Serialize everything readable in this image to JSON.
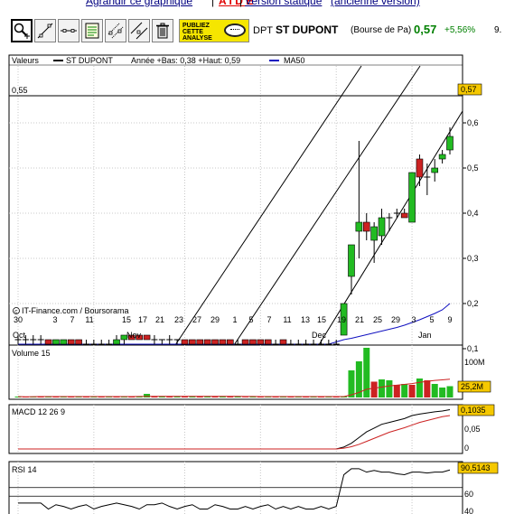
{
  "top_links": {
    "zoom": "Agrandir ce graphique",
    "sep1": "|",
    "aide": "A I D E",
    "sep2": "|",
    "static": "Version statique",
    "old": "(ancienne version)"
  },
  "toolbar": {
    "tools": [
      "zoom-tool",
      "trendline-tool",
      "horizontal-line-tool",
      "annotation-tool",
      "channel-tool",
      "parallel-lines-tool",
      "delete-tool"
    ],
    "publish_ad": [
      "PUBLIEZ",
      "CETTE",
      "ANALYSE"
    ]
  },
  "quote": {
    "mnemo": "DPT",
    "name": "ST DUPONT",
    "market": "(Bourse de Pa)",
    "last": "0,57",
    "variation": "+5,56%",
    "more": "9."
  },
  "colors": {
    "up": "#22bb22",
    "down": "#cc2222",
    "ma": "#1010c0",
    "lastbox": "#f5c800",
    "grid": "#c8c8c8"
  },
  "price_panel": {
    "header": [
      "Valeurs",
      "ST DUPONT",
      "Année +Bas: 0,38 +Haut: 0,59",
      "MA50"
    ],
    "hline_label": "0,55",
    "last_label": "0,57",
    "ticks": [
      "0,6",
      "0,5",
      "0,4",
      "0,3",
      "0,2",
      "0,1"
    ],
    "credit": "IT-Finance.com / Boursorama"
  },
  "xaxis": {
    "days": [
      "30",
      "3",
      "7",
      "11",
      "15",
      "17",
      "21",
      "23",
      "27",
      "29",
      "1",
      "5",
      "7",
      "11",
      "13",
      "15",
      "19",
      "21",
      "25",
      "29",
      "3",
      "5",
      "9"
    ],
    "months": [
      "Oct",
      "Nov",
      "Dec",
      "Jan"
    ]
  },
  "volume_panel": {
    "label": "Volume 15",
    "tick_top": "100M",
    "last": "25,2M"
  },
  "macd_panel": {
    "label": "MACD 12 26 9",
    "last": "0,1035",
    "ticks": [
      "0,05",
      "0"
    ]
  },
  "rsi_panel": {
    "label": "RSI 14",
    "last": "90,5143",
    "ticks": [
      "60",
      "40"
    ]
  },
  "chart_data": {
    "type": "candlestick",
    "ohlc": [
      [
        0.12,
        0.13,
        0.11,
        0.12
      ],
      [
        0.12,
        0.13,
        0.11,
        0.12
      ],
      [
        0.12,
        0.13,
        0.11,
        0.12
      ],
      [
        0.12,
        0.13,
        0.11,
        0.12
      ],
      [
        0.12,
        0.12,
        0.11,
        0.11
      ],
      [
        0.11,
        0.12,
        0.11,
        0.12
      ],
      [
        0.11,
        0.12,
        0.11,
        0.12
      ],
      [
        0.12,
        0.12,
        0.11,
        0.11
      ],
      [
        0.12,
        0.12,
        0.11,
        0.11
      ],
      [
        0.11,
        0.12,
        0.11,
        0.11
      ],
      [
        0.11,
        0.12,
        0.11,
        0.11
      ],
      [
        0.11,
        0.12,
        0.11,
        0.11
      ],
      [
        0.11,
        0.12,
        0.11,
        0.11
      ],
      [
        0.11,
        0.13,
        0.11,
        0.12
      ],
      [
        0.12,
        0.13,
        0.11,
        0.13
      ],
      [
        0.13,
        0.13,
        0.12,
        0.12
      ],
      [
        0.13,
        0.13,
        0.12,
        0.12
      ],
      [
        0.13,
        0.13,
        0.12,
        0.12
      ],
      [
        0.12,
        0.13,
        0.11,
        0.12
      ],
      [
        0.12,
        0.12,
        0.11,
        0.12
      ],
      [
        0.12,
        0.13,
        0.11,
        0.12
      ],
      [
        0.12,
        0.12,
        0.11,
        0.12
      ],
      [
        0.12,
        0.12,
        0.11,
        0.11
      ],
      [
        0.12,
        0.12,
        0.11,
        0.11
      ],
      [
        0.12,
        0.12,
        0.11,
        0.11
      ],
      [
        0.12,
        0.12,
        0.11,
        0.11
      ],
      [
        0.12,
        0.12,
        0.11,
        0.11
      ],
      [
        0.12,
        0.12,
        0.11,
        0.11
      ],
      [
        0.12,
        0.12,
        0.11,
        0.11
      ],
      [
        0.11,
        0.12,
        0.11,
        0.11
      ],
      [
        0.12,
        0.12,
        0.11,
        0.11
      ],
      [
        0.12,
        0.12,
        0.11,
        0.11
      ],
      [
        0.12,
        0.12,
        0.11,
        0.11
      ],
      [
        0.12,
        0.12,
        0.11,
        0.11
      ],
      [
        0.11,
        0.12,
        0.11,
        0.11
      ],
      [
        0.12,
        0.12,
        0.11,
        0.11
      ],
      [
        0.11,
        0.12,
        0.11,
        0.11
      ],
      [
        0.11,
        0.12,
        0.11,
        0.11
      ],
      [
        0.11,
        0.12,
        0.11,
        0.11
      ],
      [
        0.11,
        0.12,
        0.11,
        0.11
      ],
      [
        0.11,
        0.12,
        0.11,
        0.11
      ],
      [
        0.11,
        0.12,
        0.11,
        0.11
      ],
      [
        0.11,
        0.12,
        0.11,
        0.11
      ],
      [
        0.13,
        0.2,
        0.13,
        0.2
      ],
      [
        0.26,
        0.33,
        0.22,
        0.33
      ],
      [
        0.36,
        0.56,
        0.3,
        0.38
      ],
      [
        0.38,
        0.4,
        0.34,
        0.36
      ],
      [
        0.34,
        0.38,
        0.29,
        0.37
      ],
      [
        0.35,
        0.41,
        0.33,
        0.39
      ],
      [
        0.39,
        0.4,
        0.36,
        0.39
      ],
      [
        0.4,
        0.41,
        0.39,
        0.4
      ],
      [
        0.4,
        0.41,
        0.39,
        0.39
      ],
      [
        0.38,
        0.49,
        0.38,
        0.49
      ],
      [
        0.52,
        0.53,
        0.46,
        0.48
      ],
      [
        0.48,
        0.51,
        0.44,
        0.48
      ],
      [
        0.49,
        0.52,
        0.47,
        0.5
      ],
      [
        0.52,
        0.54,
        0.51,
        0.53
      ],
      [
        0.54,
        0.59,
        0.53,
        0.57
      ]
    ],
    "ma50": [
      0.11,
      0.11,
      0.11,
      0.11,
      0.11,
      0.11,
      0.11,
      0.11,
      0.11,
      0.11,
      0.11,
      0.11,
      0.11,
      0.11,
      0.11,
      0.11,
      0.11,
      0.11,
      0.11,
      0.11,
      0.11,
      0.11,
      0.11,
      0.11,
      0.11,
      0.11,
      0.11,
      0.11,
      0.11,
      0.11,
      0.11,
      0.11,
      0.11,
      0.11,
      0.11,
      0.11,
      0.11,
      0.11,
      0.11,
      0.11,
      0.11,
      0.11,
      0.115,
      0.12,
      0.123,
      0.127,
      0.131,
      0.135,
      0.139,
      0.143,
      0.147,
      0.152,
      0.158,
      0.164,
      0.171,
      0.178,
      0.186,
      0.2
    ],
    "volume": [
      2,
      1,
      2,
      3,
      2,
      2,
      2,
      2,
      2,
      3,
      1,
      2,
      2,
      3,
      2,
      2,
      2,
      8,
      2,
      2,
      2,
      2,
      2,
      2,
      2,
      2,
      2,
      2,
      2,
      2,
      1,
      2,
      2,
      2,
      2,
      2,
      2,
      2,
      2,
      2,
      2,
      2,
      2,
      2,
      60,
      80,
      110,
      35,
      40,
      38,
      28,
      30,
      28,
      42,
      38,
      30,
      22,
      25
    ],
    "volume_up": [
      1,
      0,
      1,
      0,
      1,
      0,
      1,
      0,
      1,
      0,
      1,
      0,
      1,
      0,
      1,
      0,
      1,
      1,
      0,
      1,
      0,
      1,
      0,
      1,
      0,
      1,
      0,
      1,
      0,
      1,
      0,
      1,
      0,
      1,
      0,
      1,
      0,
      1,
      0,
      1,
      0,
      1,
      0,
      1,
      1,
      1,
      1,
      0,
      1,
      1,
      0,
      1,
      0,
      1,
      0,
      1,
      1,
      1
    ],
    "macd": [
      0.0,
      0.0,
      0.0,
      0.0,
      0.0,
      0.0,
      0.0,
      0.0,
      0.0,
      0.0,
      0.0,
      0.0,
      0.0,
      0.0,
      0.0,
      0.0,
      0.0,
      0.0,
      0.0,
      0.0,
      0.0,
      0.0,
      0.0,
      0.0,
      0.0,
      0.0,
      0.0,
      0.0,
      0.0,
      0.0,
      0.0,
      0.0,
      0.0,
      0.0,
      0.0,
      0.0,
      0.0,
      0.0,
      0.0,
      0.0,
      0.0,
      0.0,
      0.0,
      0.005,
      0.015,
      0.03,
      0.045,
      0.055,
      0.065,
      0.07,
      0.075,
      0.08,
      0.088,
      0.092,
      0.095,
      0.098,
      0.1,
      0.1035
    ],
    "macd_signal": [
      0.0,
      0.0,
      0.0,
      0.0,
      0.0,
      0.0,
      0.0,
      0.0,
      0.0,
      0.0,
      0.0,
      0.0,
      0.0,
      0.0,
      0.0,
      0.0,
      0.0,
      0.0,
      0.0,
      0.0,
      0.0,
      0.0,
      0.0,
      0.0,
      0.0,
      0.0,
      0.0,
      0.0,
      0.0,
      0.0,
      0.0,
      0.0,
      0.0,
      0.0,
      0.0,
      0.0,
      0.0,
      0.0,
      0.0,
      0.0,
      0.0,
      0.0,
      0.0,
      0.002,
      0.006,
      0.012,
      0.02,
      0.028,
      0.036,
      0.044,
      0.05,
      0.056,
      0.063,
      0.07,
      0.075,
      0.08,
      0.085,
      0.088
    ],
    "rsi": [
      52,
      52,
      52,
      52,
      45,
      50,
      48,
      45,
      48,
      50,
      45,
      48,
      50,
      52,
      50,
      48,
      45,
      50,
      50,
      52,
      48,
      45,
      48,
      50,
      45,
      45,
      50,
      48,
      45,
      45,
      48,
      45,
      48,
      50,
      45,
      48,
      45,
      48,
      45,
      45,
      48,
      45,
      48,
      85,
      92,
      92,
      88,
      90,
      88,
      88,
      86,
      85,
      88,
      88,
      87,
      88,
      88,
      90.5
    ]
  }
}
